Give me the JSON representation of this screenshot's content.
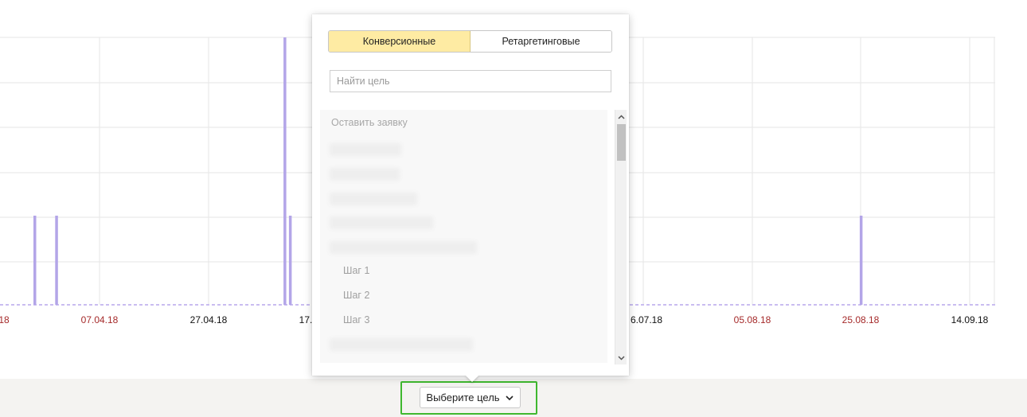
{
  "chart_data": {
    "type": "bar",
    "x_tick_labels": [
      "18",
      "07.04.18",
      "27.04.18",
      "17.",
      "6.07.18",
      "05.08.18",
      "25.08.18",
      "14.09.18"
    ],
    "x_tick_colors": [
      "#a52a2a",
      "#a52a2a",
      "#111111",
      "#111111",
      "#111111",
      "#a52a2a",
      "#a52a2a",
      "#111111"
    ],
    "bars": [
      {
        "date": "2018-03-26",
        "value": 2
      },
      {
        "date": "2018-03-30",
        "value": 2
      },
      {
        "date": "2018-05-11",
        "value": 6
      },
      {
        "date": "2018-05-12",
        "value": 2
      },
      {
        "date": "2018-08-25",
        "value": 2
      }
    ],
    "ylim": [
      0,
      6
    ],
    "grid": true,
    "bar_color": "#b3a5e8",
    "baseline_color": "#c9bdf0"
  },
  "popup": {
    "tabs": [
      {
        "label": "Конверсионные",
        "active": true
      },
      {
        "label": "Ретаргетинговые",
        "active": false
      }
    ],
    "search_placeholder": "Найти цель",
    "items": {
      "top": "Оставить заявку",
      "steps": [
        "Шаг 1",
        "Шаг 2",
        "Шаг 3"
      ]
    }
  },
  "goal_selector": {
    "label": "Выберите цель",
    "highlight_color": "#3fb82f"
  }
}
